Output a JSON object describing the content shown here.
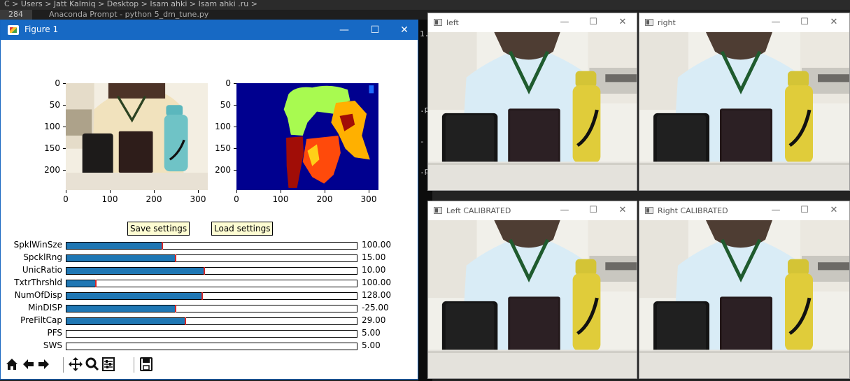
{
  "background": {
    "path_text": "C > Users > Jatt Kalmiq > Desktop > Isam ahki > Isam ahki .ru >",
    "line_number": "284",
    "taskbar_title": "Anaconda Prompt - python  5_dm_tune.py"
  },
  "figure_window": {
    "title": "Figure 1",
    "minimize": "—",
    "maximize": "☐",
    "close": "✕",
    "left_plot": {
      "y_ticks": [
        "0",
        "50",
        "100",
        "150",
        "200"
      ],
      "x_ticks": [
        "0",
        "100",
        "200",
        "300"
      ]
    },
    "right_plot": {
      "y_ticks": [
        "0",
        "50",
        "100",
        "150",
        "200"
      ],
      "x_ticks": [
        "0",
        "100",
        "200",
        "300"
      ]
    },
    "save_button": "Save settings",
    "load_button": "Load settings",
    "sliders": [
      {
        "label": "SpklWinSze",
        "value": "100.00",
        "fraction": 0.33
      },
      {
        "label": "SpcklRng",
        "value": "15.00",
        "fraction": 0.375
      },
      {
        "label": "UnicRatio",
        "value": "10.00",
        "fraction": 0.475
      },
      {
        "label": "TxtrThrshld",
        "value": "100.00",
        "fraction": 0.1
      },
      {
        "label": "NumOfDisp",
        "value": "128.00",
        "fraction": 0.468
      },
      {
        "label": "MinDISP",
        "value": "-25.00",
        "fraction": 0.375
      },
      {
        "label": "PreFiltCap",
        "value": "29.00",
        "fraction": 0.41
      },
      {
        "label": "PFS",
        "value": "5.00",
        "fraction": 0.0
      },
      {
        "label": "SWS",
        "value": "5.00",
        "fraction": 0.0
      }
    ],
    "toolbar": {
      "home": "home-icon",
      "back": "back-arrow-icon",
      "forward": "forward-arrow-icon",
      "pan": "pan-icon",
      "zoom": "zoom-icon",
      "configure": "configure-subplots-icon",
      "save": "save-icon"
    }
  },
  "camera_windows": [
    {
      "title": "left"
    },
    {
      "title": "right"
    },
    {
      "title": "Left CALIBRATED"
    },
    {
      "title": "Right CALIBRATED"
    }
  ],
  "window_buttons": {
    "minimize": "—",
    "maximize": "☐",
    "close": "✕"
  },
  "colors": {
    "titlebar_blue": "#1769c4",
    "slider_fill": "#1f77b4",
    "slider_marker": "#d62728",
    "button_bg": "#fdfcd2"
  }
}
